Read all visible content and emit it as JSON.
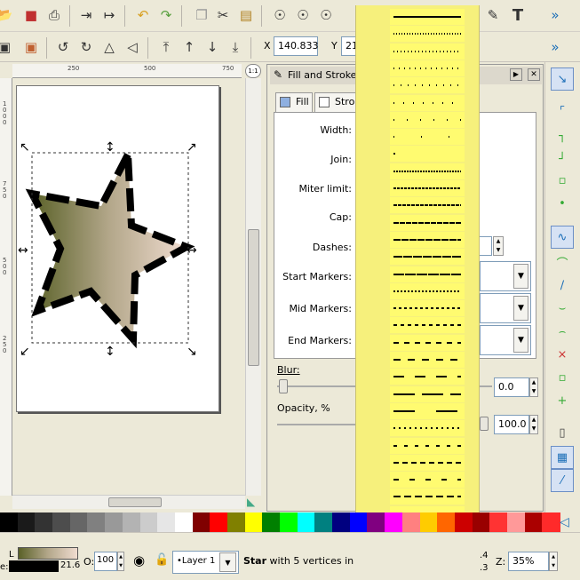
{
  "toolbar": {
    "x_label": "X",
    "x_value": "140.833",
    "y_label": "Y",
    "y_value": "21",
    "overflow": "»"
  },
  "ruler": {
    "h_ticks": [
      "250",
      "500",
      "750"
    ],
    "v_ticks": [
      "1000",
      "750",
      "500",
      "250"
    ],
    "zoom_btn": "1:1"
  },
  "dialog": {
    "title": "Fill and Stroke",
    "tab_fill": "Fill",
    "tab_stroke": "Stroke",
    "labels": {
      "width": "Width:",
      "join": "Join:",
      "miter": "Miter limit:",
      "cap": "Cap:",
      "dashes": "Dashes:",
      "start_markers": "Start Markers:",
      "mid_markers": "Mid Markers:",
      "end_markers": "End Markers:",
      "blur": "Blur:",
      "opacity": "Opacity, %"
    },
    "dash_offset_tail": "0",
    "blur_value": "0.0",
    "opacity_value": "100.0"
  },
  "dash_patterns": [
    "solid",
    "1,2",
    "1,3",
    "1,5",
    "1,7",
    "1,10",
    "1,14",
    "1,30",
    "dot",
    "2,1",
    "3,1",
    "4,1",
    "6,1",
    "8,1",
    "10,1",
    "12,1",
    "2,2",
    "3,3",
    "4,4",
    "6,6",
    "8,8",
    "12,12",
    "24,8",
    "24,24",
    "2,4",
    "4,8",
    "6,4",
    "6,12",
    "8,4",
    "10,8",
    "12,4",
    "16,6",
    "8,4,2,4"
  ],
  "palette": {
    "colors": [
      "#000000",
      "#1a1a1a",
      "#333333",
      "#4d4d4d",
      "#666666",
      "#808080",
      "#999999",
      "#b3b3b3",
      "#cccccc",
      "#e6e6e6",
      "#ffffff",
      "#800000",
      "#ff0000",
      "#808000",
      "#ffff00",
      "#008000",
      "#00ff00",
      "#00ffff",
      "#008080",
      "#000080",
      "#0000ff",
      "#800080",
      "#ff00ff",
      "#ff8080",
      "#ffcc00",
      "#ff6600",
      "#cc0000",
      "#990000",
      "#ff3333",
      "#ff9999",
      "#aa0000",
      "#ff2a2a"
    ]
  },
  "status": {
    "fill_label": "L",
    "stroke_width": "21.6",
    "stroke_label": "e:",
    "opacity_label": "O:",
    "opacity_value": "100",
    "layer": "•Layer 1",
    "message_bold": "Star",
    "message_rest": " with 5 vertices in la",
    "coord_a": ".4",
    "coord_b": ".3",
    "zoom_label": "Z:",
    "zoom_value": "35%"
  }
}
